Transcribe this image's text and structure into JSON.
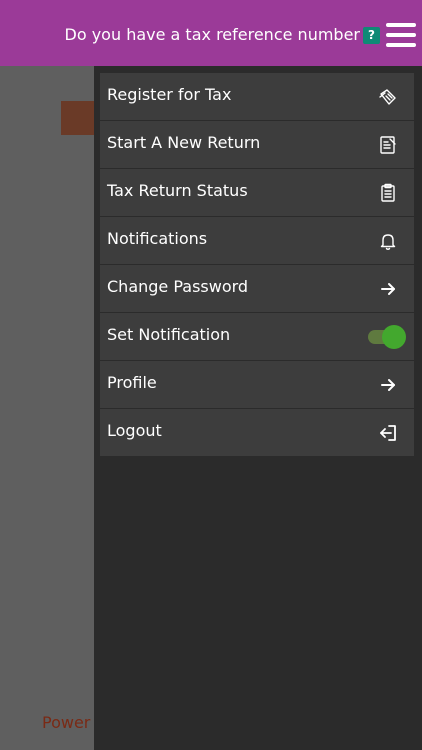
{
  "header": {
    "title": "Do you have a tax reference number",
    "help_label": "?",
    "menu_icon": "hamburger-menu-icon",
    "background_color": "#9b3a98"
  },
  "background": {
    "footer_fragment": "Power"
  },
  "drawer": {
    "items": [
      {
        "label": "Register for Tax",
        "icon": "register-tax-icon"
      },
      {
        "label": "Start A New Return",
        "icon": "new-return-icon"
      },
      {
        "label": "Tax Return Status",
        "icon": "clipboard-icon"
      },
      {
        "label": "Notifications",
        "icon": "bell-icon"
      },
      {
        "label": "Change Password",
        "icon": "arrow-right-icon"
      },
      {
        "label": "Set Notification",
        "toggle": true,
        "toggle_on": true
      },
      {
        "label": "Profile",
        "icon": "arrow-right-icon"
      },
      {
        "label": "Logout",
        "icon": "logout-icon"
      }
    ]
  },
  "colors": {
    "accent": "#9b3a98",
    "help_badge": "#0f8a76",
    "toggle_on": "#43a82e",
    "drawer_bg": "#2b2b2b",
    "item_bg": "#3d3d3d"
  }
}
